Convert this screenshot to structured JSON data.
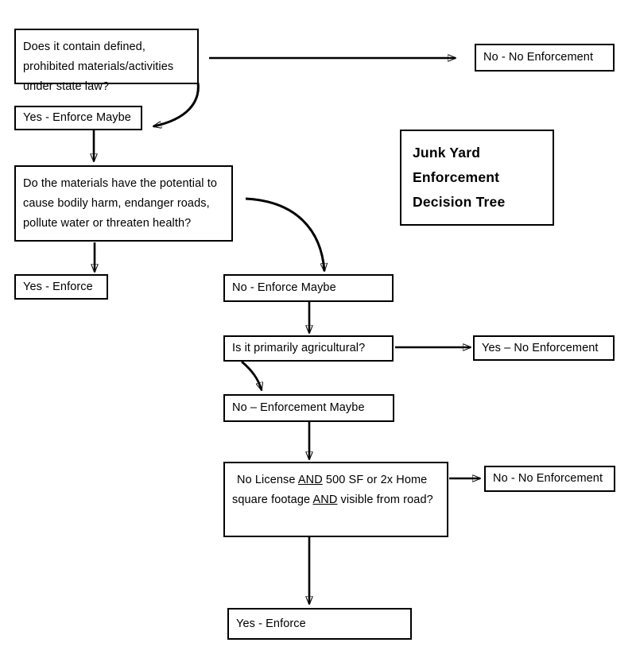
{
  "document": {
    "title": "Junk Yard Enforcement Decision Tree",
    "type": "flowchart"
  },
  "title_box": {
    "line1": "Junk Yard",
    "line2": "Enforcement",
    "line3": "Decision Tree",
    "text": "Junk Yard\nEnforcement\nDecision Tree"
  },
  "nodes": {
    "q1": {
      "id": "q1",
      "kind": "decision",
      "text": "Does it contain defined,\nprohibited materials/activities\nunder state law?"
    },
    "q1_no": {
      "id": "q1_no",
      "kind": "outcome",
      "text": "No - No Enforcement"
    },
    "q1_yes": {
      "id": "q1_yes",
      "kind": "intermediate",
      "text": "Yes - Enforce Maybe"
    },
    "q2": {
      "id": "q2",
      "kind": "decision",
      "text": "Do the materials have the potential to\ncause bodily harm, endanger roads,\npollute water or threaten health?"
    },
    "q2_yes": {
      "id": "q2_yes",
      "kind": "outcome",
      "text": "Yes - Enforce"
    },
    "q2_no": {
      "id": "q2_no",
      "kind": "intermediate",
      "text": "No - Enforce Maybe"
    },
    "q3": {
      "id": "q3",
      "kind": "decision",
      "text": "Is it primarily agricultural?"
    },
    "q3_yes": {
      "id": "q3_yes",
      "kind": "outcome",
      "text": "Yes – No Enforcement"
    },
    "q3_no": {
      "id": "q3_no",
      "kind": "intermediate",
      "text": "No – Enforcement Maybe"
    },
    "q4": {
      "id": "q4",
      "kind": "decision",
      "text_part1": " No License ",
      "text_and1": "AND",
      "text_part2": " 500 SF or 2x Home square footage ",
      "text_and2": "AND",
      "text_part3": " visible from road?",
      "text": " No License AND 500 SF or 2x Home square footage AND visible from road?"
    },
    "q4_no": {
      "id": "q4_no",
      "kind": "outcome",
      "text": "No - No Enforcement"
    },
    "q4_yes": {
      "id": "q4_yes",
      "kind": "outcome",
      "text": "Yes - Enforce"
    }
  },
  "edges": [
    {
      "from": "q1",
      "to": "q1_no",
      "style": "straight-horizontal"
    },
    {
      "from": "q1",
      "to": "q1_yes",
      "style": "curved"
    },
    {
      "from": "q1_yes",
      "to": "q2",
      "style": "straight-vertical"
    },
    {
      "from": "q2",
      "to": "q2_yes",
      "style": "straight-vertical"
    },
    {
      "from": "q2",
      "to": "q2_no",
      "style": "curved"
    },
    {
      "from": "q2_no",
      "to": "q3",
      "style": "straight-vertical"
    },
    {
      "from": "q3",
      "to": "q3_yes",
      "style": "straight-horizontal"
    },
    {
      "from": "q3",
      "to": "q3_no",
      "style": "curved"
    },
    {
      "from": "q3_no",
      "to": "q4",
      "style": "straight-vertical"
    },
    {
      "from": "q4",
      "to": "q4_no",
      "style": "straight-horizontal"
    },
    {
      "from": "q4",
      "to": "q4_yes",
      "style": "straight-vertical"
    }
  ],
  "colors": {
    "background": "#ffffff",
    "stroke": "#000000",
    "text": "#000000"
  }
}
